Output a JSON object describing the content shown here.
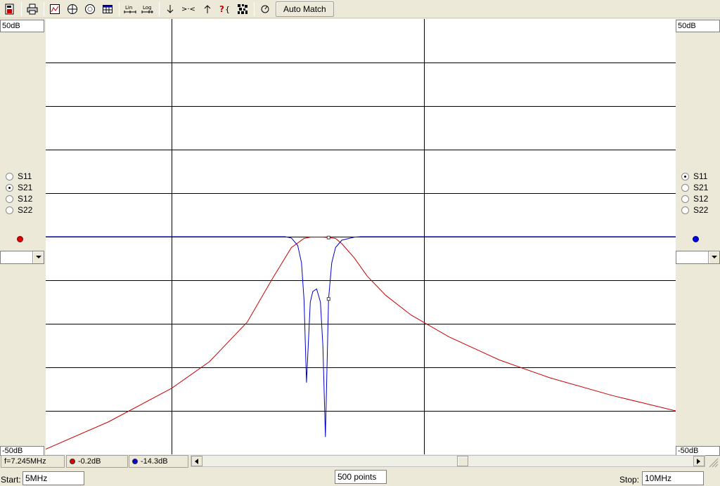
{
  "toolbar": {
    "icons": [
      "save-icon",
      "print-icon",
      "smith-chart-icon",
      "polar-icon",
      "circle-grid-icon",
      "table-icon",
      "lin-scale-icon",
      "log-scale-icon",
      "marker-down-icon",
      "zoom-icon",
      "marker-up-icon",
      "help-icon",
      "pattern-icon",
      "tune-icon"
    ],
    "lin_label": "Lin",
    "log_label": "Log",
    "auto_match_label": "Auto Match"
  },
  "left_axis": {
    "top_label": "50dB",
    "bottom_label": "-50dB",
    "params": [
      "S11",
      "S21",
      "S12",
      "S22"
    ],
    "selected": "S21",
    "trace_color": "#cc0000"
  },
  "right_axis": {
    "top_label": "50dB",
    "bottom_label": "-50dB",
    "params": [
      "S11",
      "S21",
      "S12",
      "S22"
    ],
    "selected": "S11",
    "trace_color": "#0000cc"
  },
  "chart_data": {
    "type": "line",
    "x_range_mhz": [
      5,
      10
    ],
    "y_range_db": [
      -50,
      50
    ],
    "grid": true,
    "series": [
      {
        "color": "#cc0000",
        "x": [
          5.0,
          5.5,
          6.0,
          6.3,
          6.6,
          6.8,
          6.95,
          7.05,
          7.1,
          7.15,
          7.2,
          7.245,
          7.3,
          7.35,
          7.45,
          7.55,
          7.7,
          7.9,
          8.2,
          8.6,
          9.0,
          9.5,
          10.0
        ],
        "y": [
          -48.8,
          -42.5,
          -34.8,
          -28.7,
          -19.6,
          -9.6,
          -2.5,
          -0.4,
          -0.1,
          -0.1,
          -0.1,
          -0.2,
          -0.4,
          -1.6,
          -4.9,
          -9.0,
          -13.5,
          -18.0,
          -23.0,
          -28.3,
          -32.4,
          -36.5,
          -40.0
        ]
      },
      {
        "color": "#0000cc",
        "x": [
          5.0,
          6.9,
          6.95,
          7.0,
          7.03,
          7.05,
          7.07,
          7.1,
          7.12,
          7.15,
          7.18,
          7.2,
          7.22,
          7.245,
          7.27,
          7.3,
          7.35,
          7.45,
          7.5,
          10.0
        ],
        "y": [
          0.0,
          0.0,
          -0.3,
          -2.0,
          -6.0,
          -14.5,
          -33.5,
          -15.0,
          -12.6,
          -12.0,
          -15.0,
          -25.0,
          -46.0,
          -14.3,
          -6.0,
          -2.5,
          -0.8,
          -0.1,
          0.0,
          0.0
        ]
      }
    ]
  },
  "status": {
    "frequency": "f=7.245MHz",
    "s21_value": "-0.2dB",
    "s11_value": "-14.3dB"
  },
  "bottom": {
    "start_label": "Start:",
    "start_value": "5MHz",
    "points_value": "500 points",
    "stop_label": "Stop:",
    "stop_value": "10MHz"
  }
}
